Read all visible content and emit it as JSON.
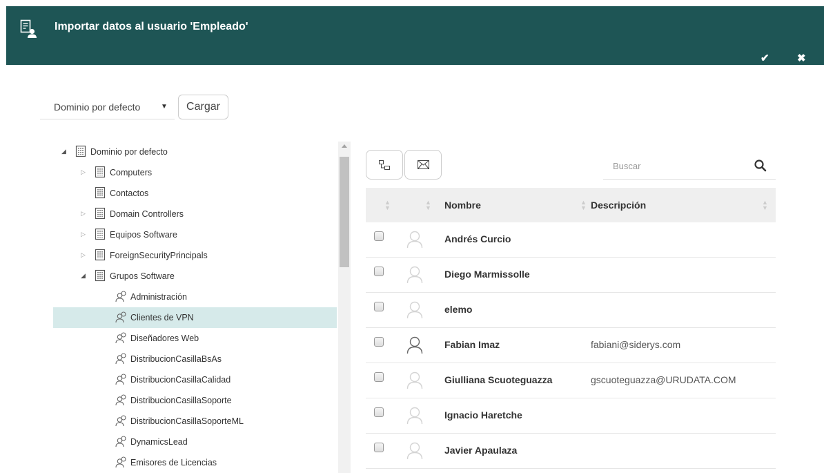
{
  "window": {
    "title": "Importar datos al usuario 'Empleado'",
    "confirm_icon": "check-icon",
    "close_icon": "close-icon"
  },
  "domain_select": {
    "value": "Dominio por defecto"
  },
  "load_button": {
    "label": "Cargar"
  },
  "tree": {
    "nodes": [
      {
        "label": "Dominio por defecto",
        "type": "container",
        "state": "expanded"
      },
      {
        "label": "Computers",
        "type": "container",
        "state": "collapsed"
      },
      {
        "label": "Contactos",
        "type": "container",
        "state": "leaf"
      },
      {
        "label": "Domain Controllers",
        "type": "container",
        "state": "collapsed"
      },
      {
        "label": "Equipos Software",
        "type": "container",
        "state": "collapsed"
      },
      {
        "label": "ForeignSecurityPrincipals",
        "type": "container",
        "state": "collapsed"
      },
      {
        "label": "Grupos Software",
        "type": "container",
        "state": "expanded"
      },
      {
        "label": "Administración",
        "type": "group",
        "state": "leaf"
      },
      {
        "label": "Clientes de VPN",
        "type": "group",
        "state": "leaf",
        "selected": true
      },
      {
        "label": "Diseñadores Web",
        "type": "group",
        "state": "leaf"
      },
      {
        "label": "DistribucionCasillaBsAs",
        "type": "group",
        "state": "leaf"
      },
      {
        "label": "DistribucionCasillaCalidad",
        "type": "group",
        "state": "leaf"
      },
      {
        "label": "DistribucionCasillaSoporte",
        "type": "group",
        "state": "leaf"
      },
      {
        "label": "DistribucionCasillaSoporteML",
        "type": "group",
        "state": "leaf"
      },
      {
        "label": "DynamicsLead",
        "type": "group",
        "state": "leaf"
      },
      {
        "label": "Emisores de Licencias",
        "type": "group",
        "state": "leaf"
      }
    ]
  },
  "toolbar": {
    "tree_view_icon": "tree-view-icon",
    "mail_icon": "envelope-icon"
  },
  "search": {
    "placeholder": "Buscar",
    "icon": "search-icon"
  },
  "grid": {
    "columns": [
      "Nombre",
      "Descripción"
    ],
    "rows": [
      {
        "name": "Andrés Curcio",
        "description": "",
        "avatar_active": false
      },
      {
        "name": "Diego Marmissolle",
        "description": "",
        "avatar_active": false
      },
      {
        "name": "elemo",
        "description": "",
        "avatar_active": false
      },
      {
        "name": "Fabian Imaz",
        "description": "fabiani@siderys.com",
        "avatar_active": true
      },
      {
        "name": "Giulliana Scuoteguazza",
        "description": "gscuoteguazza@URUDATA.COM",
        "avatar_active": false
      },
      {
        "name": "Ignacio Haretche",
        "description": "",
        "avatar_active": false
      },
      {
        "name": "Javier Apaulaza",
        "description": "",
        "avatar_active": false
      }
    ]
  },
  "colors": {
    "header_bg": "#1e5555",
    "selected_row": "#d6eaea",
    "grid_header_bg": "#efefef"
  }
}
